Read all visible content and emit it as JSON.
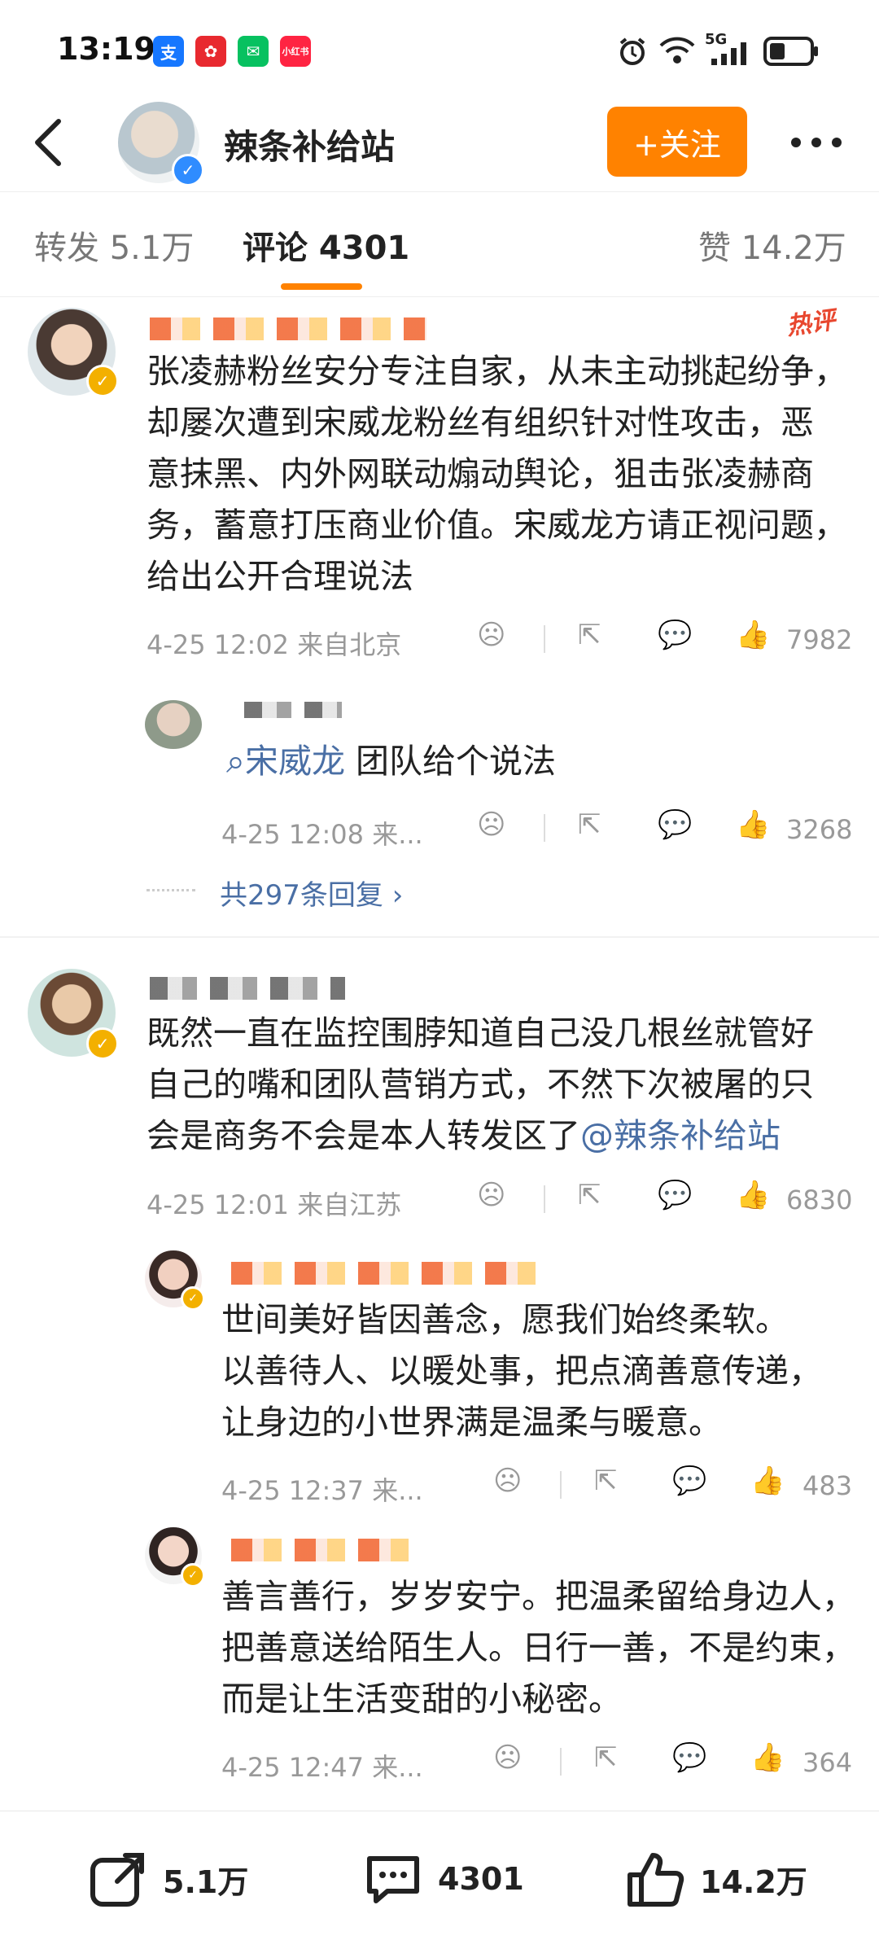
{
  "status_bar": {
    "time": "13:19",
    "apps": [
      {
        "icon": "alipay-icon",
        "label": "支",
        "color": "#1677ff"
      },
      {
        "icon": "app-red-icon",
        "label": "✿",
        "color": "#e8292f"
      },
      {
        "icon": "wechat-icon",
        "label": "✉",
        "color": "#07c160"
      },
      {
        "icon": "xiaohongshu-icon",
        "label": "小红书",
        "color": "#ff2442"
      }
    ],
    "network": "5G"
  },
  "header": {
    "title": "辣条补给站",
    "follow_label": "+关注",
    "more_label": "•••"
  },
  "tabs": [
    {
      "label": "转发 5.1万",
      "active": false
    },
    {
      "label": "评论 4301",
      "active": true
    },
    {
      "label": "赞 14.2万",
      "active": false
    }
  ],
  "comments": [
    {
      "hot_badge": "热评",
      "text": "张凌赫粉丝安分专注自家，从未主动挑起纷争，却屡次遭到宋威龙粉丝有组织针对性攻击，恶意抹黑、内外网联动煽动舆论，狙击张凌赫商务，蓄意打压商业价值。宋威龙方请正视问题，给出公开合理说法",
      "lines": [
        "张凌赫粉丝安分专注自家，从未主动挑起纷争，",
        "却屡次遭到宋威龙粉丝有组织针对性攻击，恶",
        "意抹黑、内外网联动煽动舆论，狙击张凌赫商",
        "务，蓄意打压商业价值。宋威龙方请正视问题，",
        "给出公开合理说法"
      ],
      "meta": "4-25 12:02 来自北京",
      "likes": "7982",
      "replies": [
        {
          "link": "宋威龙",
          "text": " 团队给个说法",
          "meta": "4-25 12:08 来...",
          "likes": "3268"
        }
      ],
      "more_replies": "共297条回复 ›"
    },
    {
      "lines": [
        "既然一直在监控围脖知道自己没几根丝就管好",
        "自己的嘴和团队营销方式，不然下次被屠的只",
        "会是商务不会是本人转发区了"
      ],
      "mention": "@辣条补给站",
      "meta": "4-25 12:01 来自江苏",
      "likes": "6830",
      "replies": [
        {
          "lines": [
            "世间美好皆因善念，愿我们始终柔软。",
            "以善待人、以暖处事，把点滴善意传递，",
            "让身边的小世界满是温柔与暖意。"
          ],
          "meta": "4-25 12:37 来...",
          "likes": "483"
        },
        {
          "lines": [
            "善言善行，岁岁安宁。把温柔留给身边人，",
            "把善意送给陌生人。日行一善，不是约束，",
            "而是让生活变甜的小秘密。"
          ],
          "meta": "4-25 12:47 来...",
          "likes": "364"
        }
      ]
    }
  ],
  "bottom_bar": {
    "reposts": "5.1万",
    "comments": "4301",
    "likes": "14.2万"
  }
}
